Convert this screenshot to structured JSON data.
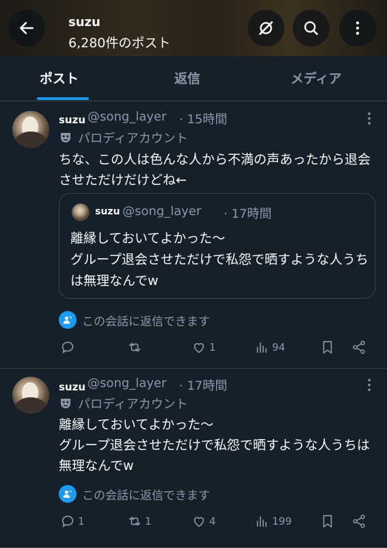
{
  "header": {
    "display_name": "suzu",
    "post_count": "6,280件のポスト"
  },
  "tabs": [
    {
      "label": "ポスト"
    },
    {
      "label": "返信"
    },
    {
      "label": "メディア"
    }
  ],
  "tweets": [
    {
      "name": "suzu",
      "handle": "@song_layer",
      "time": "· 15時間",
      "parody": "パロディアカウント",
      "body": "ちな、この人は色んな人から不満の声あったから退会させただけだけどね←",
      "quote": {
        "name": "suzu",
        "handle": "@song_layer",
        "time": "· 17時間",
        "body": "離縁しておいてよかった〜\nグループ退会させただけで私怨で晒すような人うちは無理なんでw"
      },
      "convo": "この会話に返信できます",
      "replies": "",
      "reposts": "",
      "likes": "1",
      "views": "94"
    },
    {
      "name": "suzu",
      "handle": "@song_layer",
      "time": "· 17時間",
      "parody": "パロディアカウント",
      "body": "離縁しておいてよかった〜\nグループ退会させただけで私怨で晒すような人うちは無理なんでw",
      "convo": "この会話に返信できます",
      "replies": "1",
      "reposts": "1",
      "likes": "4",
      "views": "199"
    }
  ],
  "colors": {
    "background": "#15202b",
    "accent": "#1d9bf0",
    "muted": "#8b98a5",
    "border": "#38444d"
  }
}
